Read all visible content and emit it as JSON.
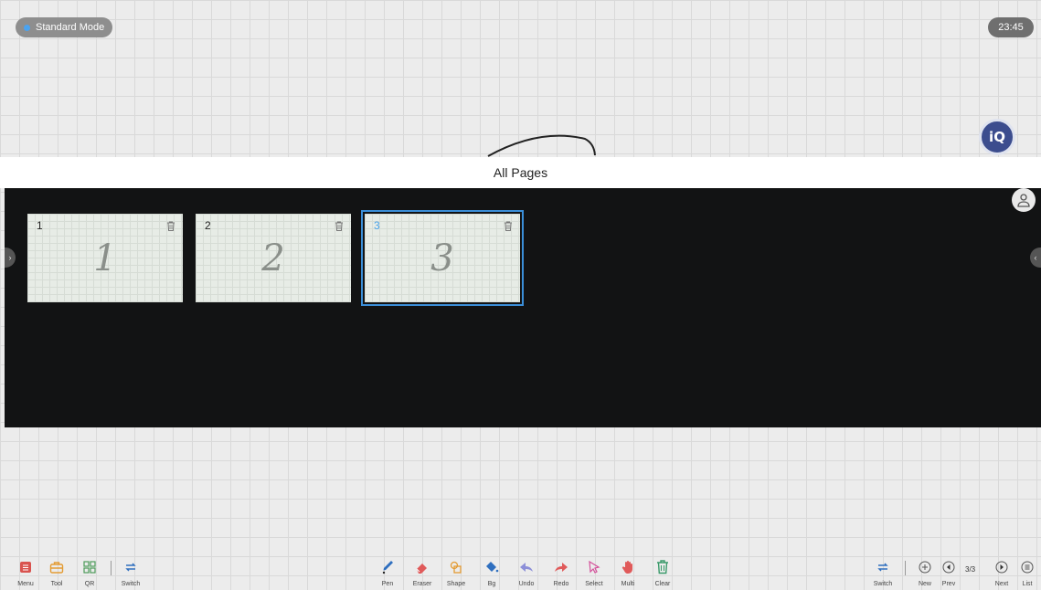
{
  "status": {
    "mode_label": "Standard Mode",
    "clock": "23:45"
  },
  "brand": {
    "badge": "iQ"
  },
  "pages_panel": {
    "title": "All Pages",
    "pages": [
      {
        "number": "1",
        "content": "1",
        "selected": false
      },
      {
        "number": "2",
        "content": "2",
        "selected": false
      },
      {
        "number": "3",
        "content": "3",
        "selected": true
      }
    ]
  },
  "toolbar": {
    "left": {
      "menu": "Menu",
      "tool": "Tool",
      "qr": "QR",
      "switch": "Switch"
    },
    "center": {
      "pen": "Pen",
      "eraser": "Eraser",
      "shape": "Shape",
      "bg": "Bg",
      "undo": "Undo",
      "redo": "Redo",
      "select": "Select",
      "multi": "Multi",
      "clear": "Clear"
    },
    "right": {
      "switch": "Switch",
      "new": "New",
      "prev": "Prev",
      "page_counter": "3/3",
      "next": "Next",
      "list": "List"
    }
  },
  "colors": {
    "accent": "#3b8ed8",
    "menu_red": "#d9534f",
    "tool_orange": "#e39b33",
    "qr_green": "#4e9b5a",
    "pen_blue": "#2f6fbf",
    "eraser_red": "#e05a5a",
    "select_pink": "#d4509a",
    "clear_green": "#3a9a6a"
  }
}
